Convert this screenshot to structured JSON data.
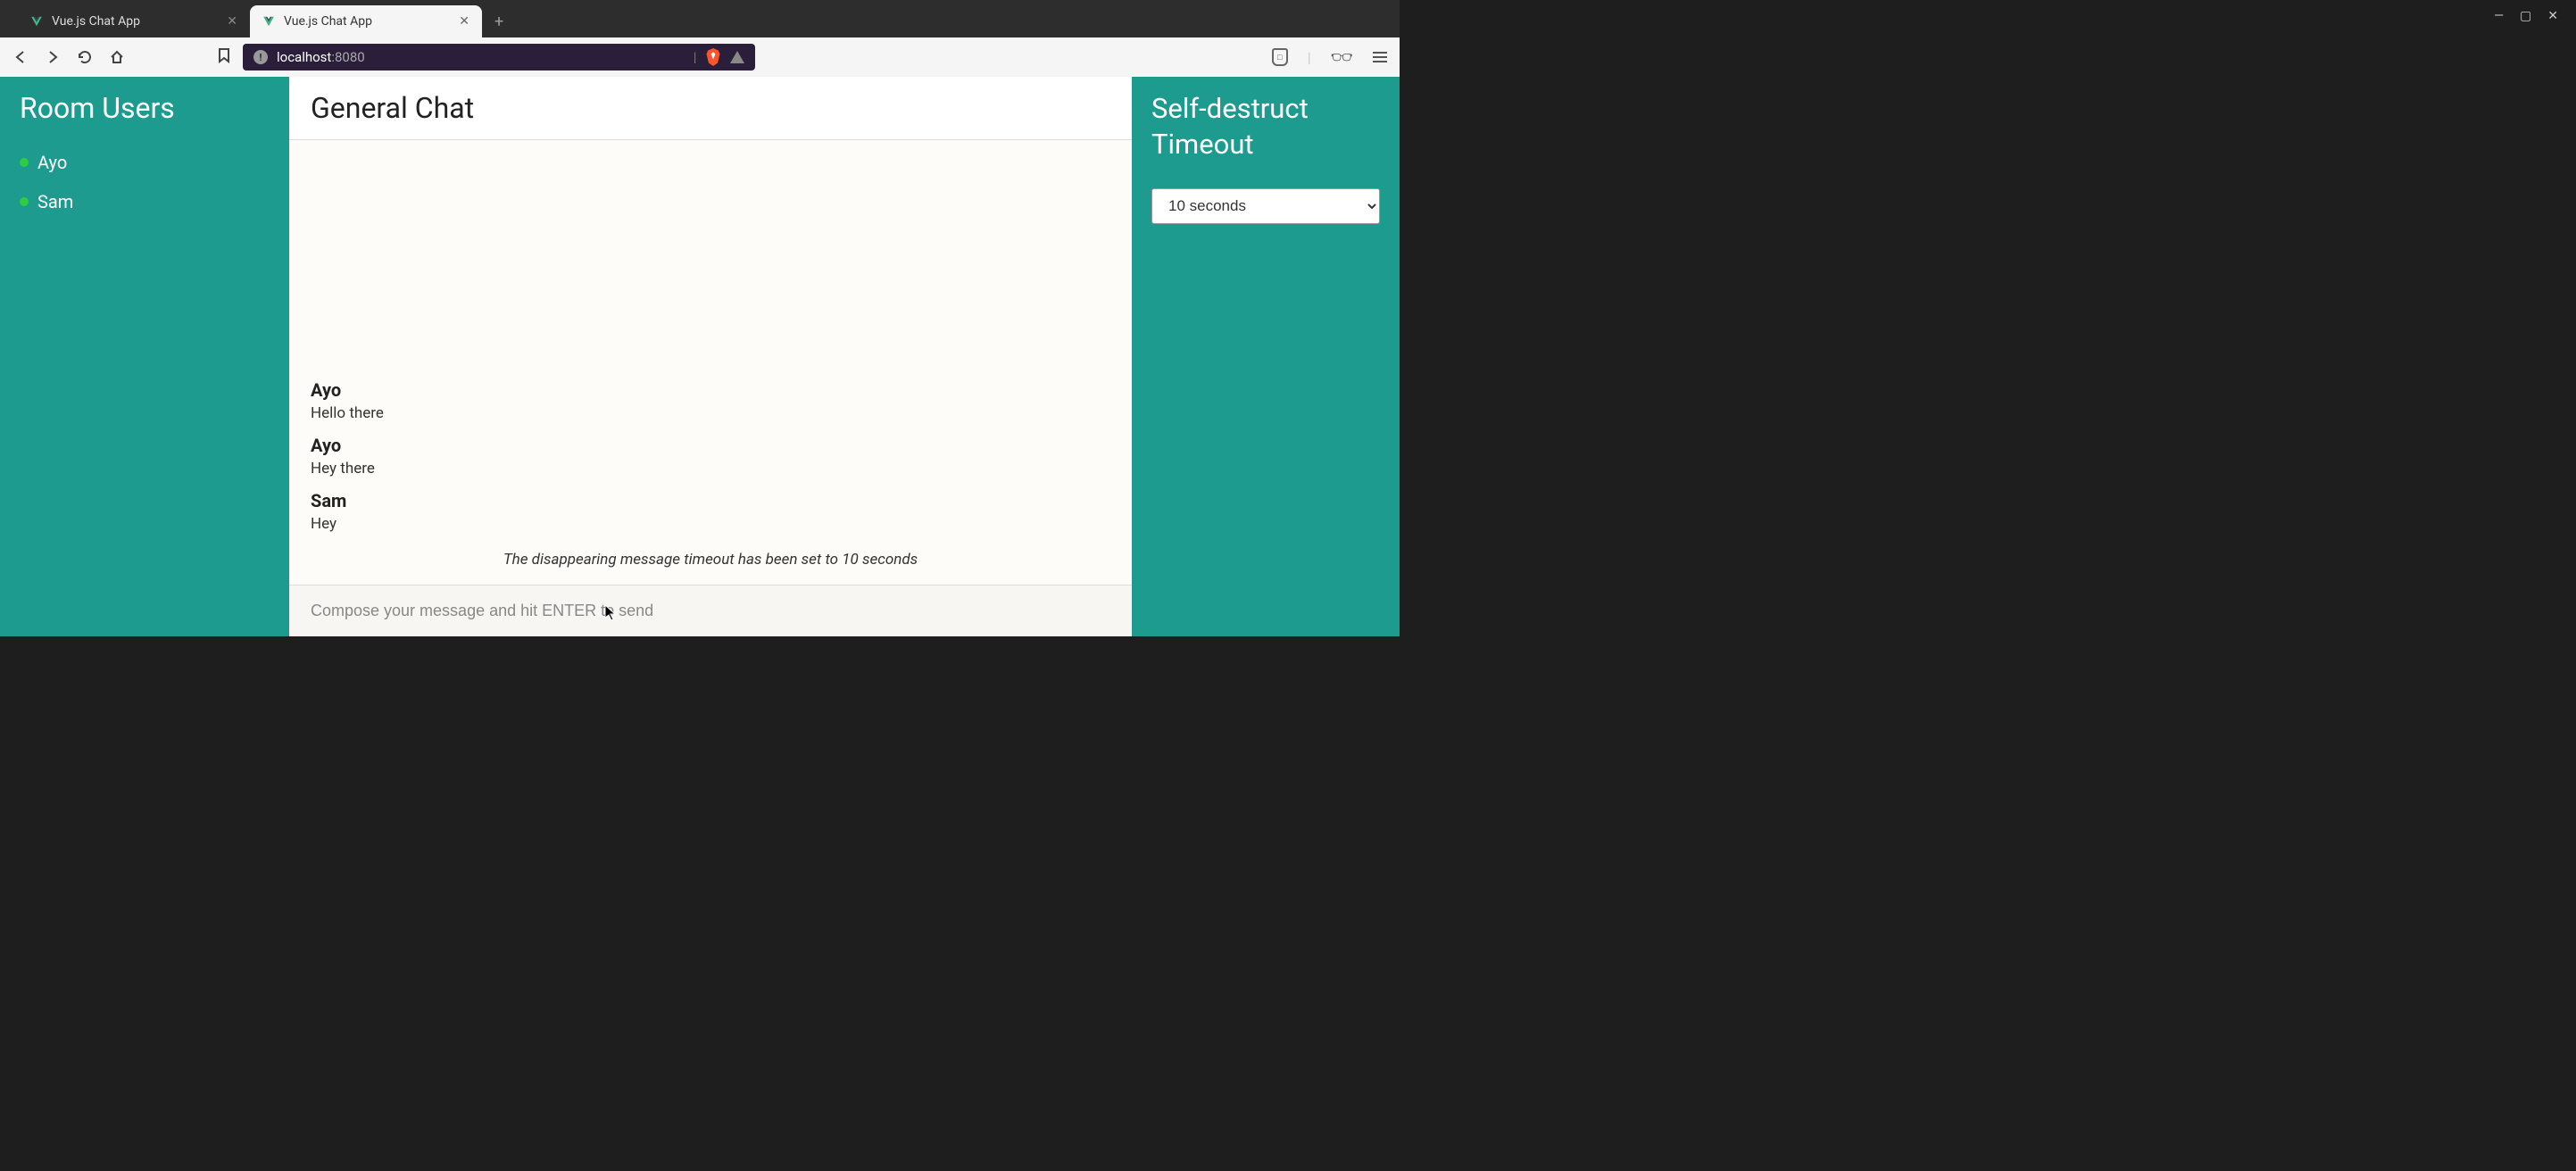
{
  "window": {
    "tabs": [
      {
        "title": "Vue.js Chat App",
        "active": false
      },
      {
        "title": "Vue.js Chat App",
        "active": true
      }
    ]
  },
  "address": {
    "host": "localhost",
    "port": ":8080"
  },
  "sidebar_left": {
    "title": "Room Users",
    "users": [
      {
        "name": "Ayo",
        "online": true
      },
      {
        "name": "Sam",
        "online": true
      }
    ]
  },
  "chat": {
    "header": "General Chat",
    "messages": [
      {
        "author": "Ayo",
        "text": "Hello there"
      },
      {
        "author": "Ayo",
        "text": "Hey there"
      },
      {
        "author": "Sam",
        "text": "Hey"
      }
    ],
    "system_message": "The disappearing message timeout has been set to 10 seconds",
    "compose_placeholder": "Compose your message and hit ENTER to send"
  },
  "sidebar_right": {
    "title": "Self-destruct Timeout",
    "selected": "10 seconds"
  }
}
